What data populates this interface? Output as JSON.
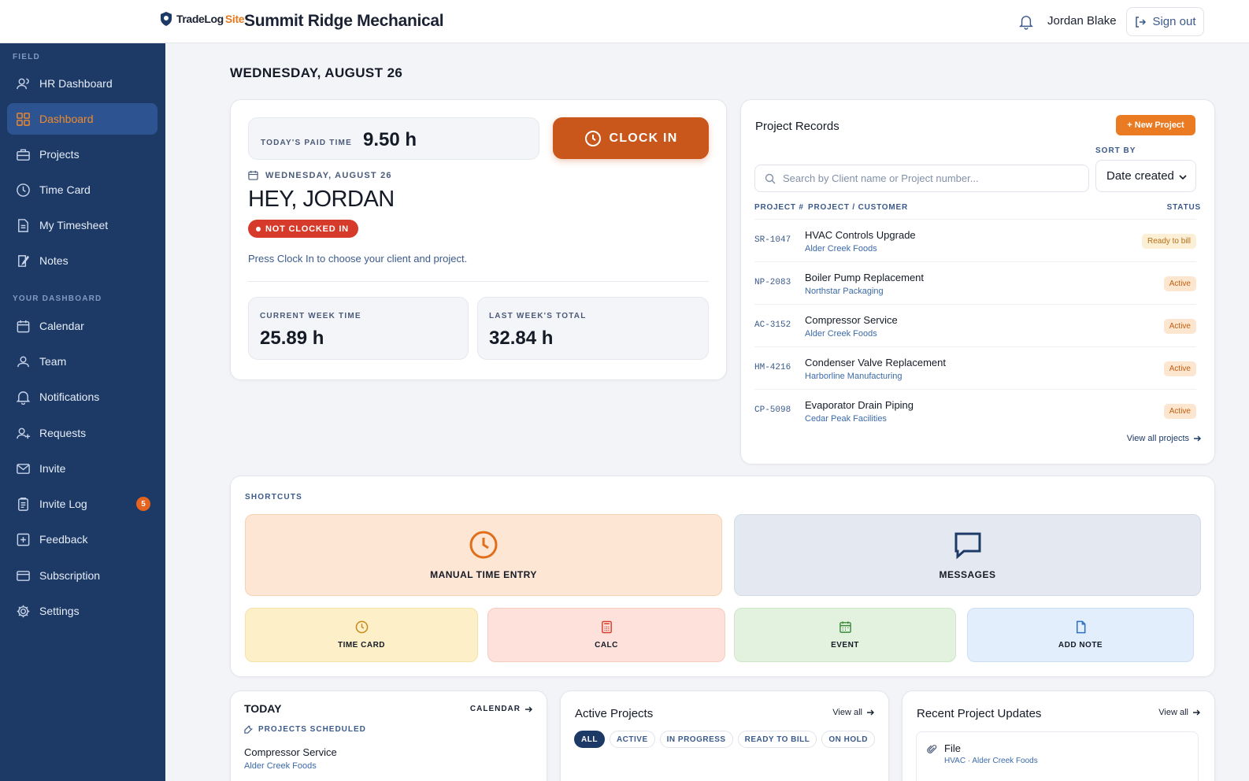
{
  "brand": {
    "name": "TradeLog",
    "suffix": "Site"
  },
  "company": "Summit Ridge Mechanical",
  "user": {
    "name": "Jordan Blake",
    "signout": "Sign out"
  },
  "sidebar": {
    "sections": [
      "FIELD",
      "YOUR DASHBOARD"
    ],
    "field_items": [
      {
        "label": "HR Dashboard",
        "icon": "users-icon"
      },
      {
        "label": "Dashboard",
        "icon": "grid-icon",
        "active": true
      },
      {
        "label": "Projects",
        "icon": "briefcase-icon"
      },
      {
        "label": "Time Card",
        "icon": "clock-icon"
      },
      {
        "label": "My Timesheet",
        "icon": "timesheet-icon"
      },
      {
        "label": "Notes",
        "icon": "notes-icon"
      }
    ],
    "dash_items": [
      {
        "label": "Calendar",
        "icon": "calendar-icon"
      },
      {
        "label": "Team",
        "icon": "team-icon"
      },
      {
        "label": "Notifications",
        "icon": "bell-icon"
      },
      {
        "label": "Requests",
        "icon": "user-plus-icon"
      },
      {
        "label": "Invite",
        "icon": "mail-icon"
      },
      {
        "label": "Invite Log",
        "icon": "log-icon",
        "badge": "5"
      },
      {
        "label": "Feedback",
        "icon": "feedback-icon"
      },
      {
        "label": "Subscription",
        "icon": "card-icon"
      },
      {
        "label": "Settings",
        "icon": "gear-icon"
      }
    ]
  },
  "main": {
    "date_heading": "WEDNESDAY, AUGUST 26",
    "clock": {
      "paid_label": "TODAY'S PAID TIME",
      "paid_value": "9.50 h",
      "clock_in": "CLOCK IN",
      "date": "WEDNESDAY, AUGUST 26",
      "greeting": "HEY, JORDAN",
      "status": "NOT CLOCKED IN",
      "hint": "Press Clock In to choose your client and project.",
      "current_week_label": "CURRENT WEEK TIME",
      "current_week_value": "25.89 h",
      "last_week_label": "LAST WEEK'S TOTAL",
      "last_week_value": "32.84 h"
    },
    "projects": {
      "title": "Project Records",
      "new_button": "+ New Project",
      "sort_label": "SORT BY",
      "sort_value": "Date created",
      "search_placeholder": "Search by Client name or Project number...",
      "headers": [
        "PROJECT #",
        "PROJECT / CUSTOMER",
        "STATUS"
      ],
      "rows": [
        {
          "num": "SR-1047",
          "name": "HVAC Controls Upgrade",
          "customer": "Alder Creek Foods",
          "status": "Ready to bill"
        },
        {
          "num": "NP-2083",
          "name": "Boiler Pump Replacement",
          "customer": "Northstar Packaging",
          "status": "Active"
        },
        {
          "num": "AC-3152",
          "name": "Compressor Service",
          "customer": "Alder Creek Foods",
          "status": "Active"
        },
        {
          "num": "HM-4216",
          "name": "Condenser Valve Replacement",
          "customer": "Harborline Manufacturing",
          "status": "Active"
        },
        {
          "num": "CP-5098",
          "name": "Evaporator Drain Piping",
          "customer": "Cedar Peak Facilities",
          "status": "Active"
        }
      ],
      "view_all": "View all projects"
    },
    "shortcuts": {
      "label": "SHORTCUTS",
      "manual": "MANUAL TIME ENTRY",
      "messages": "MESSAGES",
      "time_card": "TIME CARD",
      "calc": "CALC",
      "event": "EVENT",
      "add_note": "ADD NOTE"
    },
    "today": {
      "title": "TODAY",
      "calendar_link": "CALENDAR",
      "scheduled_label": "PROJECTS SCHEDULED",
      "item_name": "Compressor Service",
      "item_customer": "Alder Creek Foods"
    },
    "active_projects": {
      "title": "Active Projects",
      "view_all": "View all",
      "filters": [
        "ALL",
        "ACTIVE",
        "IN PROGRESS",
        "READY TO BILL",
        "ON HOLD"
      ]
    },
    "updates": {
      "title": "Recent Project Updates",
      "view_all": "View all",
      "item_title": "File",
      "item_sub": "HVAC · Alder Creek Foods"
    }
  },
  "colors": {
    "navy": "#1d3a66",
    "orange": "#ea7b22",
    "clock_in": "#c9561a",
    "status_red": "#d63a2a"
  }
}
